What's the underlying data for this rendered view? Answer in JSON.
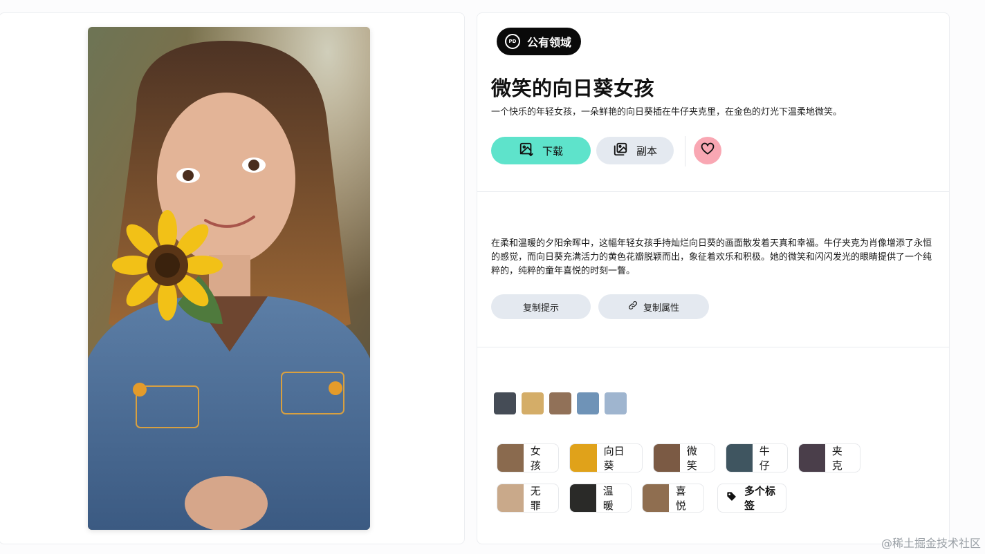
{
  "image": {
    "alt": "微笑的向日葵女孩"
  },
  "license": {
    "icon_text": "PD",
    "label": "公有领域"
  },
  "title": "微笑的向日葵女孩",
  "subtitle": "一个快乐的年轻女孩，一朵鲜艳的向日葵插在牛仔夹克里，在金色的灯光下温柔地微笑。",
  "actions": {
    "download_label": "下载",
    "copy_label": "副本",
    "like_icon": "heart-icon"
  },
  "description": "在柔和温暖的夕阳余晖中，这幅年轻女孩手持灿烂向日葵的画面散发着天真和幸福。牛仔夹克为肖像增添了永恒的感觉，而向日葵充满活力的黄色花瓣脱颖而出，象征着欢乐和积极。她的微笑和闪闪发光的眼睛提供了一个纯粹的，纯粹的童年喜悦的时刻一瞥。",
  "prompt_actions": {
    "copy_prompt": "复制提示",
    "copy_attributes": "复制属性"
  },
  "palette": [
    "#454c56",
    "#d4ad68",
    "#917158",
    "#6f93b7",
    "#9fb5cf"
  ],
  "tags": [
    {
      "label": "女孩",
      "thumb": "#8a6a4e"
    },
    {
      "label": "向日葵",
      "thumb": "#e0a21a"
    },
    {
      "label": "微笑",
      "thumb": "#7b5a44"
    },
    {
      "label": "牛仔",
      "thumb": "#3f5560"
    },
    {
      "label": "夹克",
      "thumb": "#4a3e4a"
    },
    {
      "label": "无罪",
      "thumb": "#c9a98a"
    },
    {
      "label": "温暖",
      "thumb": "#2a2a28"
    },
    {
      "label": "喜悦",
      "thumb": "#8f6e50"
    }
  ],
  "more_tags_label": "多个标签",
  "watermark": "@稀土掘金技术社区"
}
